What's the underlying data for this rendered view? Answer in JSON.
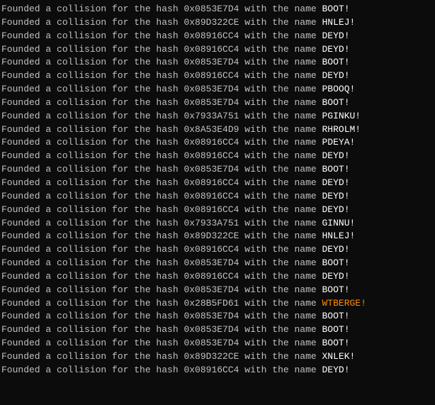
{
  "lines": [
    {
      "prefix": "Founded a collision for the hash ",
      "hash": "0x0853E7D4",
      "mid": " with the name ",
      "name": "BOOT!",
      "nameColor": "normal"
    },
    {
      "prefix": "Founded a collision for the hash ",
      "hash": "0x89D322CE",
      "mid": " with the name ",
      "name": "HNLEJ!",
      "nameColor": "normal"
    },
    {
      "prefix": "Founded a collision for the hash ",
      "hash": "0x08916CC4",
      "mid": " with the name ",
      "name": "DEYD!",
      "nameColor": "normal"
    },
    {
      "prefix": "Founded a collision for the hash ",
      "hash": "0x08916CC4",
      "mid": " with the name ",
      "name": "DEYD!",
      "nameColor": "normal"
    },
    {
      "prefix": "Founded a collision for the hash ",
      "hash": "0x0853E7D4",
      "mid": " with the name ",
      "name": "BOOT!",
      "nameColor": "normal"
    },
    {
      "prefix": "Founded a collision for the hash ",
      "hash": "0x08916CC4",
      "mid": " with the name ",
      "name": "DEYD!",
      "nameColor": "normal"
    },
    {
      "prefix": "Founded a collision for the hash ",
      "hash": "0x0853E7D4",
      "mid": " with the name ",
      "name": "PBOOQ!",
      "nameColor": "normal"
    },
    {
      "prefix": "Founded a collision for the hash ",
      "hash": "0x0853E7D4",
      "mid": " with the name ",
      "name": "BOOT!",
      "nameColor": "normal"
    },
    {
      "prefix": "Founded a collision for the hash ",
      "hash": "0x7933A751",
      "mid": " with the name ",
      "name": "PGINKU!",
      "nameColor": "normal"
    },
    {
      "prefix": "Founded a collision for the hash ",
      "hash": "0x8A53E4D9",
      "mid": " with the name ",
      "name": "RHROLM!",
      "nameColor": "normal"
    },
    {
      "prefix": "Founded a collision for the hash ",
      "hash": "0x08916CC4",
      "mid": " with the name ",
      "name": "PDEYA!",
      "nameColor": "normal"
    },
    {
      "prefix": "Founded a collision for the hash ",
      "hash": "0x08916CC4",
      "mid": " with the name ",
      "name": "DEYD!",
      "nameColor": "normal"
    },
    {
      "prefix": "Founded a collision for the hash ",
      "hash": "0x0853E7D4",
      "mid": " with the name ",
      "name": "BOOT!",
      "nameColor": "normal"
    },
    {
      "prefix": "Founded a collision for the hash ",
      "hash": "0x08916CC4",
      "mid": " with the name ",
      "name": "DEYD!",
      "nameColor": "normal"
    },
    {
      "prefix": "Founded a collision for the hash ",
      "hash": "0x08916CC4",
      "mid": " with the name ",
      "name": "DEYD!",
      "nameColor": "normal"
    },
    {
      "prefix": "Founded a collision for the hash ",
      "hash": "0x08916CC4",
      "mid": " with the name ",
      "name": "DEYD!",
      "nameColor": "normal"
    },
    {
      "prefix": "Founded a collision for the hash ",
      "hash": "0x7933A751",
      "mid": " with the name ",
      "name": "GINNU!",
      "nameColor": "normal"
    },
    {
      "prefix": "Founded a collision for the hash ",
      "hash": "0x89D322CE",
      "mid": " with the name ",
      "name": "HNLEJ!",
      "nameColor": "normal"
    },
    {
      "prefix": "Founded a collision for the hash ",
      "hash": "0x08916CC4",
      "mid": " with the name ",
      "name": "DEYD!",
      "nameColor": "normal"
    },
    {
      "prefix": "Founded a collision for the hash ",
      "hash": "0x0853E7D4",
      "mid": " with the name ",
      "name": "BOOT!",
      "nameColor": "normal"
    },
    {
      "prefix": "Founded a collision for the hash ",
      "hash": "0x08916CC4",
      "mid": " with the name ",
      "name": "DEYD!",
      "nameColor": "normal"
    },
    {
      "prefix": "Founded a collision for the hash ",
      "hash": "0x0853E7D4",
      "mid": " with the name ",
      "name": "BOOT!",
      "nameColor": "normal"
    },
    {
      "prefix": "Founded a collision for the hash ",
      "hash": "0x28B5FD61",
      "mid": " with the name ",
      "name": "WTBERGE!",
      "nameColor": "orange"
    },
    {
      "prefix": "Founded a collision for the hash ",
      "hash": "0x0853E7D4",
      "mid": " with the name ",
      "name": "BOOT!",
      "nameColor": "normal"
    },
    {
      "prefix": "Founded a collision for the hash ",
      "hash": "0x0853E7D4",
      "mid": " with the name ",
      "name": "BOOT!",
      "nameColor": "normal"
    },
    {
      "prefix": "Founded a collision for the hash ",
      "hash": "0x0853E7D4",
      "mid": " with the name ",
      "name": "BOOT!",
      "nameColor": "normal"
    },
    {
      "prefix": "Founded a collision for the hash ",
      "hash": "0x89D322CE",
      "mid": " with the name ",
      "name": "XNLEK!",
      "nameColor": "normal"
    },
    {
      "prefix": "Founded a collision for the hash ",
      "hash": "0x08916CC4",
      "mid": " with the name ",
      "name": "DEYD!",
      "nameColor": "normal"
    }
  ]
}
